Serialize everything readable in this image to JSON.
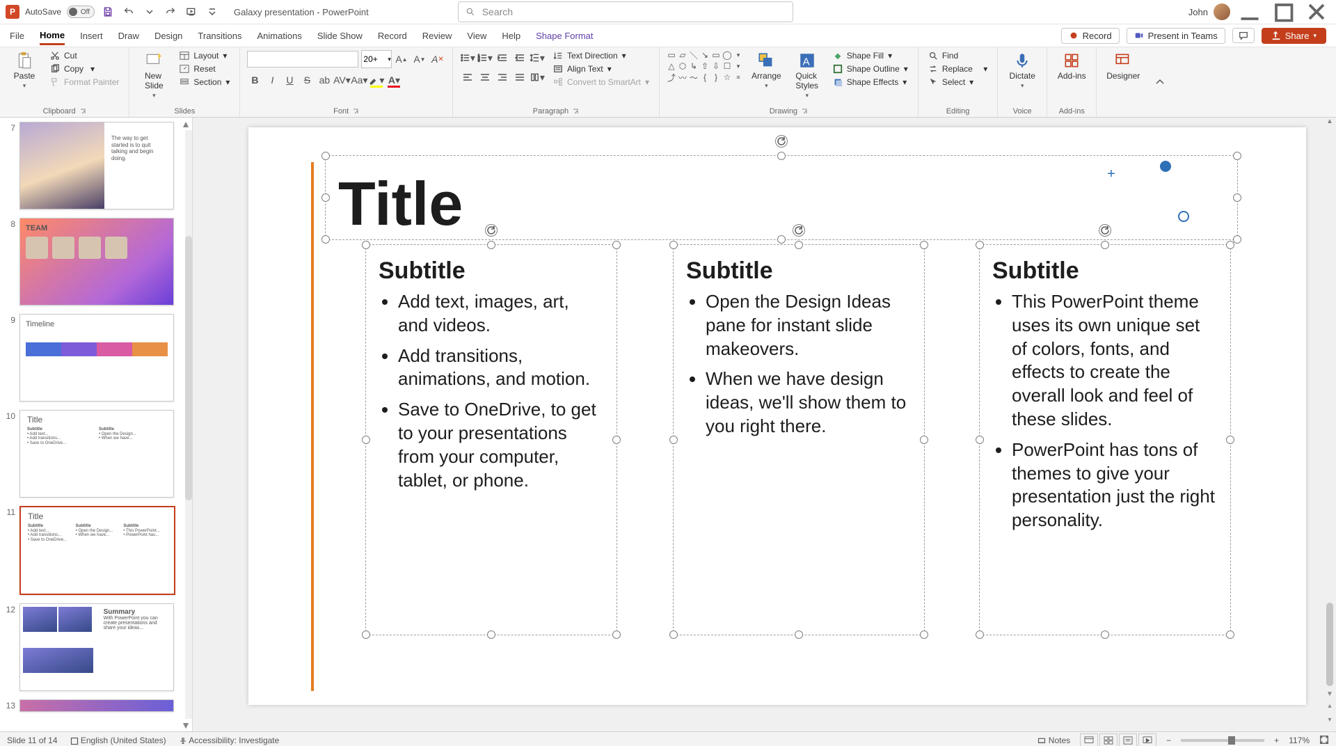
{
  "titleBar": {
    "autosave_label": "AutoSave",
    "autosave_state": "Off",
    "doc_title": "Galaxy presentation  -  PowerPoint",
    "search_placeholder": "Search",
    "user": "John"
  },
  "tabs": {
    "file": "File",
    "home": "Home",
    "insert": "Insert",
    "draw": "Draw",
    "design": "Design",
    "transitions": "Transitions",
    "animations": "Animations",
    "slideshow": "Slide Show",
    "record": "Record",
    "review": "Review",
    "view": "View",
    "help": "Help",
    "shape_format": "Shape Format",
    "record_btn": "Record",
    "present_btn": "Present in Teams",
    "share_btn": "Share"
  },
  "ribbon": {
    "clipboard": {
      "paste": "Paste",
      "cut": "Cut",
      "copy": "Copy",
      "format_painter": "Format Painter",
      "group": "Clipboard"
    },
    "slides": {
      "new_slide": "New\nSlide",
      "layout": "Layout",
      "reset": "Reset",
      "section": "Section",
      "group": "Slides"
    },
    "font": {
      "font_family": "",
      "font_size": "20+",
      "group": "Font"
    },
    "paragraph": {
      "text_direction": "Text Direction",
      "align_text": "Align Text",
      "smartart": "Convert to SmartArt",
      "group": "Paragraph"
    },
    "drawing": {
      "arrange": "Arrange",
      "quick_styles": "Quick\nStyles",
      "shape_fill": "Shape Fill",
      "shape_outline": "Shape Outline",
      "shape_effects": "Shape Effects",
      "group": "Drawing"
    },
    "editing": {
      "find": "Find",
      "replace": "Replace",
      "select": "Select",
      "group": "Editing"
    },
    "voice": {
      "dictate": "Dictate",
      "group": "Voice"
    },
    "addins": {
      "addins": "Add-ins",
      "group": "Add-ins"
    },
    "designer": {
      "designer": "Designer"
    }
  },
  "thumbnails": [
    {
      "num": "7",
      "kind": "quote",
      "title": "",
      "body": "The way to get started is to quit talking and begin doing."
    },
    {
      "num": "8",
      "kind": "team",
      "title": "TEAM"
    },
    {
      "num": "9",
      "kind": "timeline",
      "title": "Timeline"
    },
    {
      "num": "10",
      "kind": "three",
      "title": "Title"
    },
    {
      "num": "11",
      "kind": "three",
      "title": "Title",
      "selected": true
    },
    {
      "num": "12",
      "kind": "summary",
      "title": "Summary"
    },
    {
      "num": "13",
      "kind": "other",
      "title": ""
    }
  ],
  "slide": {
    "title": "Title",
    "columns": [
      {
        "subtitle": "Subtitle",
        "bullets": [
          "Add text, images, art, and videos.",
          "Add transitions, animations, and motion.",
          "Save to OneDrive, to get to your presentations from your computer, tablet, or phone."
        ]
      },
      {
        "subtitle": "Subtitle",
        "bullets": [
          "Open the Design Ideas pane for instant slide makeovers.",
          "When we have design ideas, we'll show them to you right there."
        ]
      },
      {
        "subtitle": "Subtitle",
        "bullets": [
          "This PowerPoint theme uses its own unique set of colors, fonts, and effects to create the overall look and feel of these slides.",
          "PowerPoint has tons of themes to give your presentation just the right personality."
        ]
      }
    ]
  },
  "statusBar": {
    "slide_info": "Slide 11 of 14",
    "language": "English (United States)",
    "accessibility": "Accessibility: Investigate",
    "notes": "Notes",
    "zoom": "117%"
  }
}
